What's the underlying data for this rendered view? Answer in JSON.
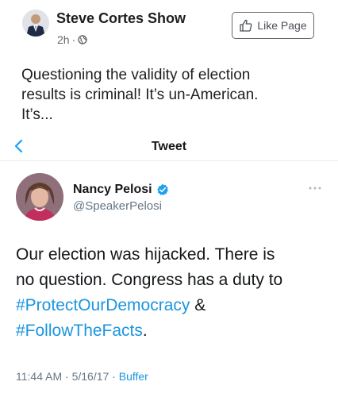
{
  "facebook_post": {
    "page_name": "Steve Cortes Show",
    "time_ago": "2h",
    "separator": "·",
    "privacy_icon": "globe-icon",
    "like_button_label": "Like Page",
    "like_icon": "thumbs-up-icon",
    "text_line_1": "Questioning the validity of election",
    "text_line_2": "results is criminal! It’s un-American.",
    "text_line_3": "It’s..."
  },
  "tweet_header": {
    "back_icon": "chevron-left-icon",
    "title": "Tweet"
  },
  "tweet": {
    "author_name": "Nancy Pelosi",
    "verified_icon": "verified-badge-icon",
    "handle": "@SpeakerPelosi",
    "more_icon": "more-dots-icon",
    "line_1": "Our election was hijacked. There is",
    "line_2": "no question. Congress has a duty to",
    "hashtag_1": "#ProtectOurDemocracy",
    "amp": " &",
    "hashtag_2": "#FollowTheFacts",
    "period": ".",
    "time": "11:44 AM",
    "date": "5/16/17",
    "dot": " · ",
    "source": "Buffer"
  },
  "colors": {
    "link_blue": "#1b95e0",
    "verified_blue": "#1da1f2",
    "fb_gray": "#65676b"
  }
}
